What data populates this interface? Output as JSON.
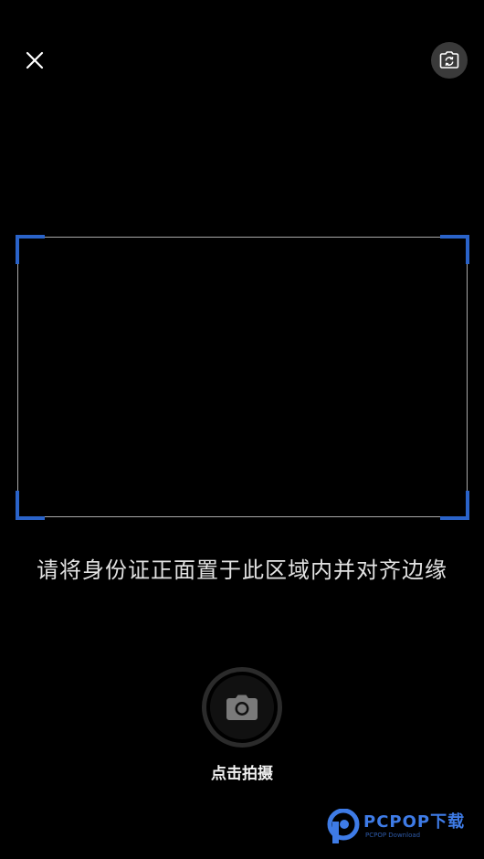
{
  "header": {
    "close_icon": "close-icon",
    "switch_camera_icon": "camera-switch-icon"
  },
  "scan_frame": {
    "corner_color": "#2a63c9",
    "border_color": "#a9a9a9"
  },
  "hint_text": "请将身份证正面置于此区域内并对齐边缘",
  "shutter": {
    "icon": "camera-icon",
    "label": "点击拍摄"
  },
  "watermark": {
    "brand": "PCPOP下载",
    "subtitle": "PCPOP Download",
    "color": "#3e7be6"
  }
}
